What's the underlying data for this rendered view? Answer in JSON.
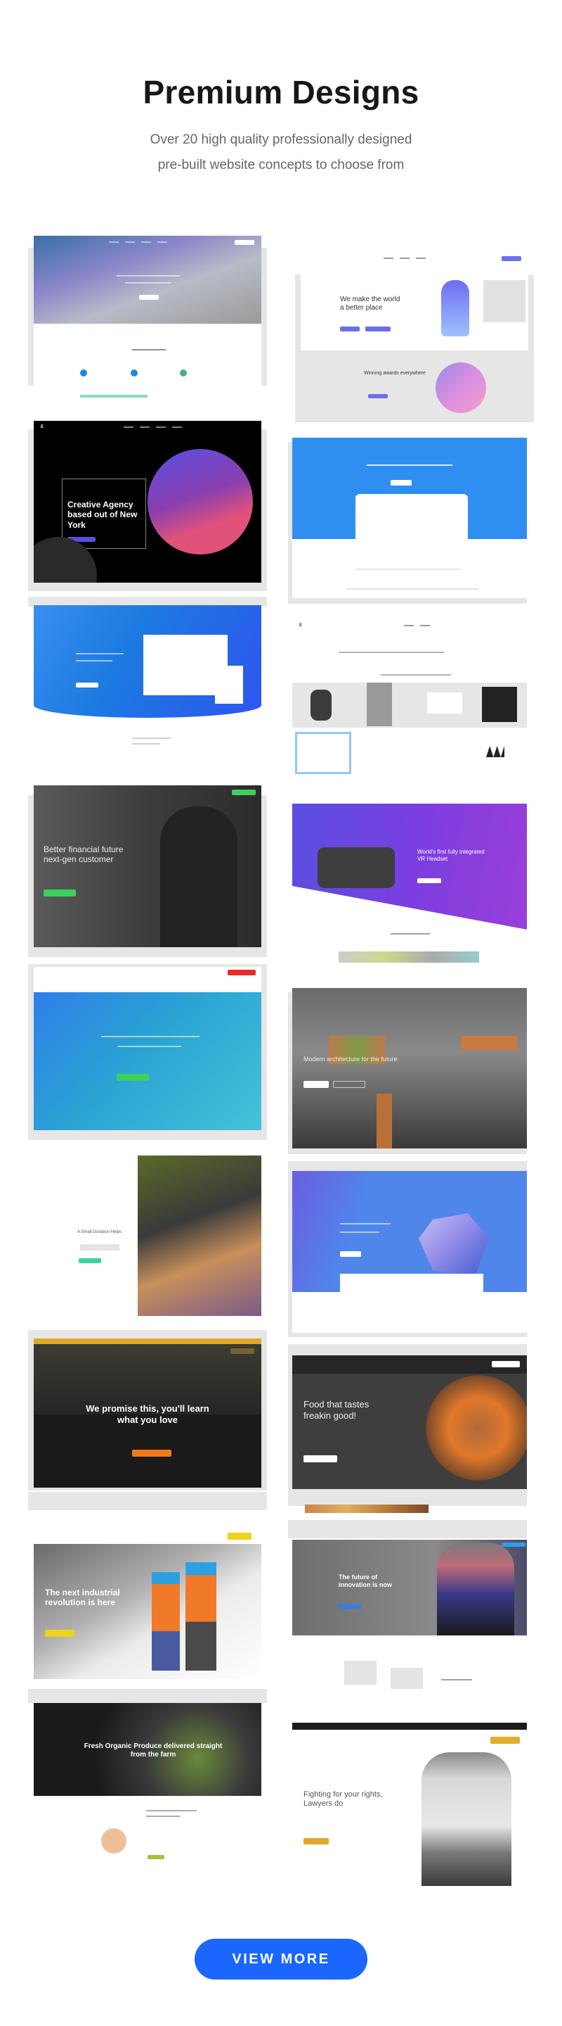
{
  "header": {
    "title": "Premium Designs",
    "subtitle_line1": "Over 20 high quality professionally designed",
    "subtitle_line2": "pre-built website concepts to choose from"
  },
  "accent_color": "#1a66ff",
  "concepts": [
    {
      "id": "landing-mountain",
      "headline": "",
      "theme": "blue-purple gradient"
    },
    {
      "id": "startup-illustration",
      "headline": "We make the world a better place",
      "section_title": "Winning awards everywhere",
      "theme": "white illustration"
    },
    {
      "id": "creative-agency",
      "headline": "Creative Agency based out of New York",
      "theme": "black with gradient sphere"
    },
    {
      "id": "saas-app",
      "headline": "",
      "theme": "blue dashboard"
    },
    {
      "id": "app-showcase",
      "headline": "",
      "theme": "blue curved"
    },
    {
      "id": "shop",
      "headline": "",
      "theme": "white product grid"
    },
    {
      "id": "finance",
      "headline": "Better financial future next-gen customer",
      "theme": "dark photo green CTA"
    },
    {
      "id": "vr-product",
      "headline": "World's first fully integrated VR Headset",
      "theme": "purple diagonal"
    },
    {
      "id": "hosting",
      "headline": "",
      "theme": "cyan red-topbar"
    },
    {
      "id": "architecture",
      "headline": "Modern architecture for the future",
      "theme": "dark house photo"
    },
    {
      "id": "charity",
      "headline": "A Small Donation Helps",
      "theme": "white child photo"
    },
    {
      "id": "isometric-tech",
      "headline": "",
      "theme": "blue isometric"
    },
    {
      "id": "education",
      "headline": "We promise this, you'll learn what you love",
      "theme": "dark orange CTA"
    },
    {
      "id": "restaurant",
      "headline": "Food that tastes freakin good!",
      "theme": "dark food"
    },
    {
      "id": "industrial",
      "headline": "The next industrial revolution is here",
      "theme": "workers yellow CTA"
    },
    {
      "id": "innovation",
      "headline": "The future of innovation is now",
      "theme": "gray portrait blue CTA"
    },
    {
      "id": "organic",
      "headline": "Fresh Organic Produce delivered straight from the farm",
      "theme": "dark produce"
    },
    {
      "id": "lawyer",
      "headline": "Fighting for your rights, Lawyers do",
      "theme": "white monochrome portrait"
    }
  ],
  "footer": {
    "view_more_label": "VIEW MORE"
  }
}
